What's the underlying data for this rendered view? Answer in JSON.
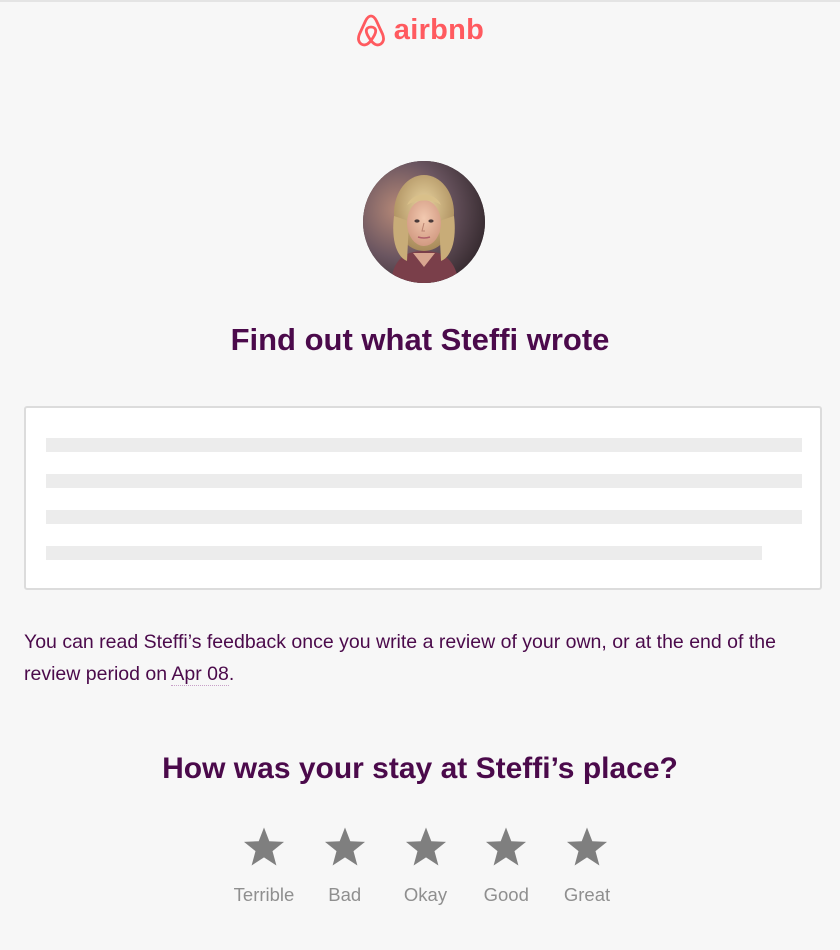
{
  "brand": {
    "name": "airbnb",
    "color": "#ff5a5f"
  },
  "host": {
    "avatar_icon": "host-profile-photo"
  },
  "title": "Find out what Steffi wrote",
  "feedback": {
    "text_before": "You can read Steffi’s feedback once you write a review of your own, or at the end of the review period on ",
    "date": "Apr 08",
    "text_after": "."
  },
  "rating": {
    "question": "How was your stay at Steffi’s place?",
    "options": [
      "Terrible",
      "Bad",
      "Okay",
      "Good",
      "Great"
    ],
    "star_icon": "star-icon"
  },
  "colors": {
    "heading": "#4b0a4b",
    "star": "#7f7f7f",
    "background": "#f7f7f7"
  }
}
